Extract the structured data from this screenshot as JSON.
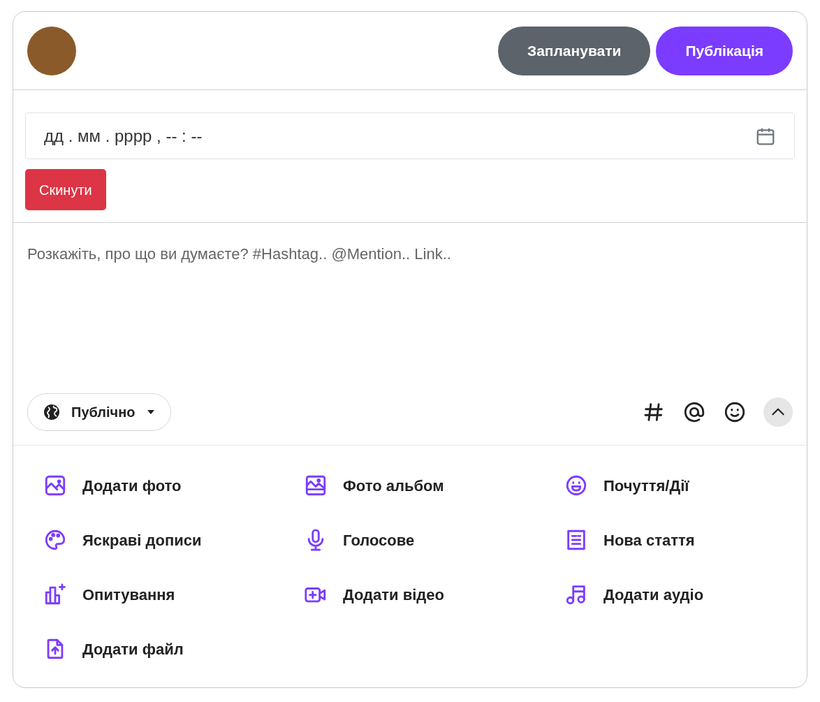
{
  "header": {
    "buttons": [
      {
        "label": "Запланувати",
        "kind": "secondary"
      },
      {
        "label": "Публікація",
        "kind": "primary"
      }
    ]
  },
  "schedule": {
    "datetime_value": "дд . мм . рррр ,  -- : --",
    "reset_button": "Скинути"
  },
  "composer": {
    "placeholder": "Розкажіть, про що ви думаєте? #Hashtag.. @Mention.. Link.."
  },
  "privacy": {
    "label": "Публічно"
  },
  "tools": [
    {
      "kind": "hashtag"
    },
    {
      "kind": "mention"
    },
    {
      "kind": "emoji"
    }
  ],
  "options_expanded": true,
  "options": [
    {
      "label": "Додати фото",
      "kind": "photo"
    },
    {
      "label": "Фото альбом",
      "kind": "album"
    },
    {
      "label": "Почуття/Дії",
      "kind": "feeling"
    },
    {
      "label": "Яскраві дописи",
      "kind": "palette"
    },
    {
      "label": "Голосове",
      "kind": "voice"
    },
    {
      "label": "Нова стаття",
      "kind": "article"
    },
    {
      "label": "Опитування",
      "kind": "poll"
    },
    {
      "label": "Додати відео",
      "kind": "video"
    },
    {
      "label": "Додати аудіо",
      "kind": "audio"
    },
    {
      "label": "Додати файл",
      "kind": "file"
    }
  ]
}
